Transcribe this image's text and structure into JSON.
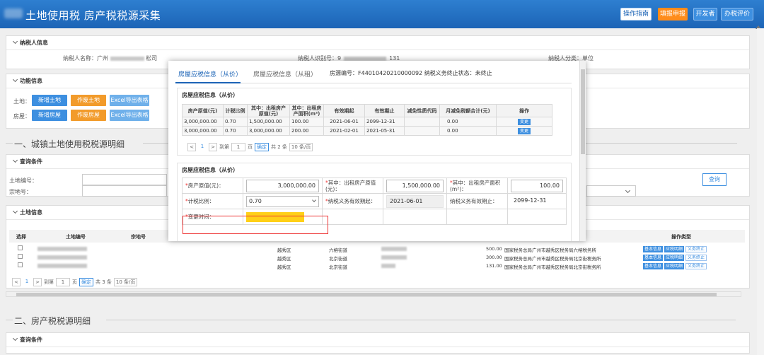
{
  "header": {
    "title": "土地使用税 房产税税源采集",
    "buttons": [
      {
        "label": "操作指南",
        "style": "white"
      },
      {
        "label": "填报申报",
        "style": "orange"
      },
      {
        "label": "开发者",
        "style": "blue"
      },
      {
        "label": "办税评价",
        "style": "blue"
      }
    ]
  },
  "taxpayer": {
    "section": "纳税人信息",
    "name_label": "纳税人名称：广州",
    "name_suffix": "松司",
    "id_label": "纳税人识别号：9",
    "id_suffix": "131",
    "type_label": "纳税人分类：单位"
  },
  "function": {
    "section": "功能信息",
    "land_label": "土地：",
    "house_label": "房屋：",
    "land_buttons": [
      "新增土地",
      "作废土地",
      "Excel导出表格"
    ],
    "house_buttons": [
      "新增房屋",
      "作废房屋",
      "Excel导出表格"
    ]
  },
  "section1": {
    "title": "一、城镇土地使用税税源明细"
  },
  "query": {
    "section": "查询条件",
    "land_no_label": "土地编号：",
    "parcel_label": "宗地号：",
    "query_button": "查询"
  },
  "land_info": {
    "section": "土地信息",
    "headers": [
      "选择",
      "土地编号",
      "宗地号",
      "操作类型"
    ],
    "rows": [
      {
        "district": "越秀区",
        "street": "六榕街道",
        "area": "500.00",
        "office": "国家税务总局广州市越秀区税务局六榕税务所"
      },
      {
        "district": "越秀区",
        "street": "北京街道",
        "area": "300.00",
        "office": "国家税务总局广州市越秀区税务局北京街税务所"
      },
      {
        "district": "越秀区",
        "street": "北京街道",
        "area": "131.00",
        "office": "国家税务总局广州市越秀区税务局北京街税务所"
      }
    ],
    "row_buttons": [
      "基本信息",
      "应税明细",
      "义务终止"
    ],
    "pager": {
      "prev": "<",
      "page": "1",
      "next": ">",
      "goto": "到第",
      "page_input": "1",
      "page_unit": "页",
      "confirm": "确定",
      "total": "共 3 条",
      "size": "10 条/页"
    }
  },
  "section2": {
    "title": "二、房产税税源明细"
  },
  "query2": {
    "section": "查询条件"
  },
  "modal": {
    "tabs": [
      "房屋应税信息（从价）",
      "房屋应税信息（从租）"
    ],
    "house_no": "房源编号：F44010420210000092",
    "status": "纳税义务终止状态：未终止",
    "list_title": "房屋应税信息（从价）",
    "table_headers": [
      "房产原值(元)",
      "计税比例",
      "其中：出租房产原值(元)",
      "其中：出租房产面积(m²)",
      "有效期起",
      "有效期止",
      "减免性质代码",
      "月减免税额合计(元)",
      "操作"
    ],
    "table_rows": [
      [
        "3,000,000.00",
        "0.70",
        "1,500,000.00",
        "100.00",
        "2021-06-01",
        "2099-12-31",
        "",
        "0.00",
        "变更"
      ],
      [
        "3,000,000.00",
        "0.70",
        "3,000,000.00",
        "200.00",
        "2021-02-01",
        "2021-05-31",
        "",
        "0.00",
        "变更"
      ]
    ],
    "pager": {
      "prev": "<",
      "page": "1",
      "next": ">",
      "goto": "到第",
      "page_input": "1",
      "page_unit": "页",
      "confirm": "确定",
      "total": "共 2 条",
      "size": "10 条/页"
    },
    "form_title": "房屋应税信息（从价）",
    "form": {
      "original_value_label": "房产原值(元)：",
      "original_value": "3,000,000.00",
      "rent_value_label": "其中：出租房产原值(元)：",
      "rent_value": "1,500,000.00",
      "rent_area_label": "其中：出租房产面积(m²)：",
      "rent_area": "100.00",
      "ratio_label": "计税比例：",
      "ratio": "0.70",
      "start_label": "纳税义务有效期起：",
      "start": "2021-06-01",
      "end_label": "纳税义务有效期止：",
      "end": "2099-12-31",
      "change_time_label": "变更时间：",
      "required_mark": "*"
    }
  },
  "colors": {
    "header_blue": "#1c64b6",
    "orange": "#ff8c1a",
    "highlight": "#ffd017",
    "red_frame": "#e33333"
  }
}
